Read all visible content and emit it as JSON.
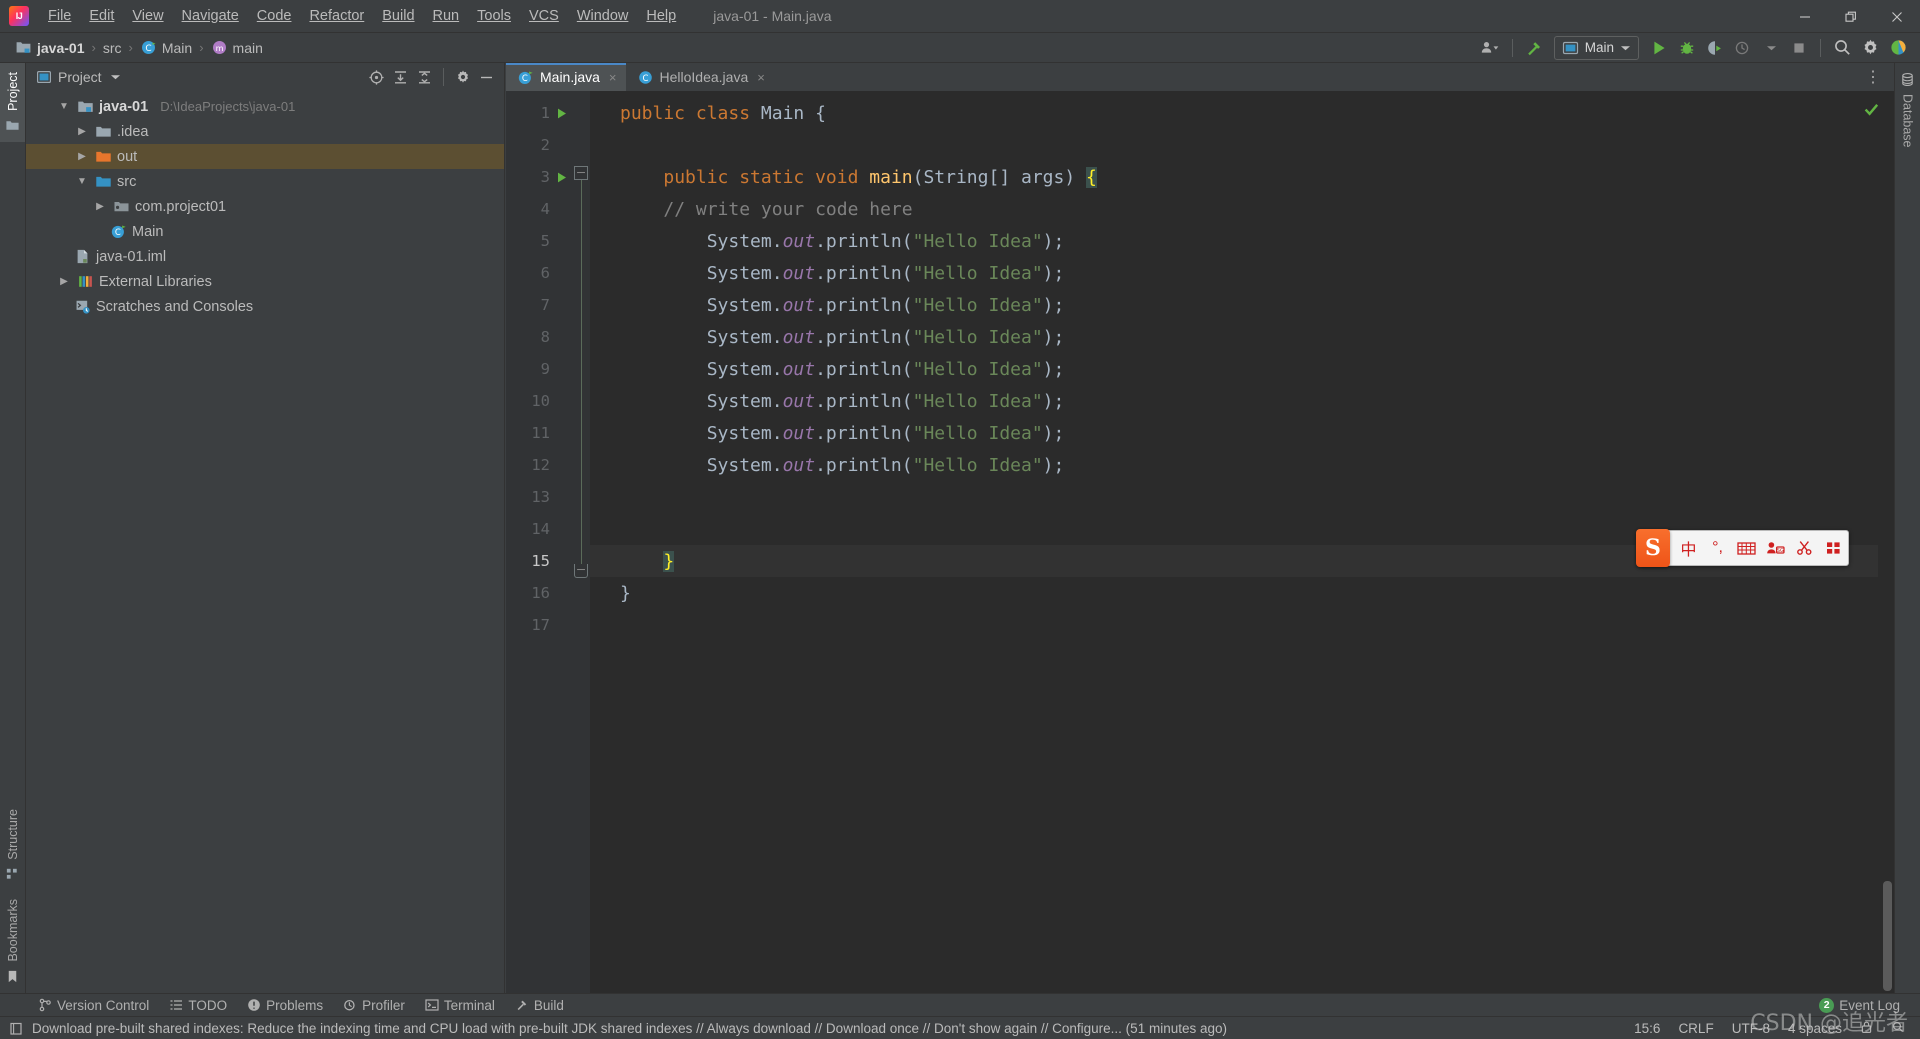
{
  "window": {
    "title": "java-01 - Main.java",
    "minimize_label": "Minimize",
    "restore_label": "Restore",
    "close_label": "Close"
  },
  "menu": {
    "items": [
      {
        "label": "File"
      },
      {
        "label": "Edit"
      },
      {
        "label": "View"
      },
      {
        "label": "Navigate"
      },
      {
        "label": "Code"
      },
      {
        "label": "Refactor"
      },
      {
        "label": "Build"
      },
      {
        "label": "Run"
      },
      {
        "label": "Tools"
      },
      {
        "label": "VCS"
      },
      {
        "label": "Window"
      },
      {
        "label": "Help"
      }
    ]
  },
  "navbar": {
    "breadcrumbs": [
      {
        "label": "java-01",
        "icon": "project-icon"
      },
      {
        "label": "src",
        "icon": "folder-icon"
      },
      {
        "label": "Main",
        "icon": "class-icon"
      },
      {
        "label": "main",
        "icon": "method-icon"
      }
    ],
    "separator": "›",
    "run_config": "Main",
    "buttons": {
      "account": "Account",
      "build_hammer": "Build Project",
      "run": "Run 'Main'",
      "debug": "Debug 'Main'",
      "run_coverage": "Run with Coverage",
      "profile": "Profile",
      "stop": "Stop",
      "search_everywhere": "Search Everywhere",
      "settings": "Settings",
      "updates": "Updates"
    }
  },
  "left_stripe": {
    "top": [
      {
        "label": "Project",
        "icon": "project-folder-icon",
        "active": true
      }
    ],
    "bottom": [
      {
        "label": "Structure",
        "icon": "structure-icon",
        "active": false
      },
      {
        "label": "Bookmarks",
        "icon": "bookmark-icon",
        "active": false
      }
    ]
  },
  "right_stripe": {
    "items": [
      {
        "label": "Database",
        "icon": "database-icon",
        "active": false
      }
    ]
  },
  "project_panel": {
    "title": "Project",
    "header_buttons": [
      {
        "name": "select-opened-file-icon",
        "label": "Select Opened File"
      },
      {
        "name": "expand-all-icon",
        "label": "Expand All"
      },
      {
        "name": "collapse-all-icon",
        "label": "Collapse All"
      },
      {
        "name": "gear-icon",
        "label": "Options"
      },
      {
        "name": "hide-icon",
        "label": "Hide"
      }
    ],
    "tree": [
      {
        "label": "java-01",
        "path": "D:\\IdeaProjects\\java-01",
        "depth": 0,
        "arrow": "expanded",
        "icon": "project-root-icon",
        "bold": true,
        "selected": false
      },
      {
        "label": ".idea",
        "path": "",
        "depth": 1,
        "arrow": "collapsed",
        "icon": "folder-icon",
        "bold": false,
        "selected": false
      },
      {
        "label": "out",
        "path": "",
        "depth": 1,
        "arrow": "collapsed",
        "icon": "folder-excluded-icon",
        "bold": false,
        "selected": true
      },
      {
        "label": "src",
        "path": "",
        "depth": 1,
        "arrow": "expanded",
        "icon": "folder-source-icon",
        "bold": false,
        "selected": false
      },
      {
        "label": "com.project01",
        "path": "",
        "depth": 2,
        "arrow": "collapsed",
        "icon": "package-icon",
        "bold": false,
        "selected": false
      },
      {
        "label": "Main",
        "path": "",
        "depth": 2,
        "arrow": "none",
        "icon": "class-runnable-icon",
        "bold": false,
        "selected": false
      },
      {
        "label": "java-01.iml",
        "path": "",
        "depth": 1,
        "arrow": "none",
        "icon": "iml-file-icon",
        "bold": false,
        "selected": false
      },
      {
        "label": "External Libraries",
        "path": "",
        "depth": 0,
        "arrow": "collapsed",
        "icon": "libraries-icon",
        "bold": false,
        "selected": false
      },
      {
        "label": "Scratches and Consoles",
        "path": "",
        "depth": 0,
        "arrow": "none",
        "icon": "scratches-icon",
        "bold": false,
        "selected": false
      }
    ]
  },
  "editor": {
    "tabs": [
      {
        "label": "Main.java",
        "icon": "class-runnable-icon",
        "active": true,
        "close": "×"
      },
      {
        "label": "HelloIdea.java",
        "icon": "class-icon",
        "active": false,
        "close": "×"
      }
    ],
    "more_label": "⋮",
    "inspection_status": "no-errors",
    "caret_line": 15,
    "lines": [
      {
        "n": 1,
        "run": true,
        "caret": false,
        "tokens": [
          {
            "t": "public ",
            "c": "kw"
          },
          {
            "t": "class ",
            "c": "kw"
          },
          {
            "t": "Main {",
            "c": "plain"
          }
        ]
      },
      {
        "n": 2,
        "run": false,
        "caret": false,
        "tokens": []
      },
      {
        "n": 3,
        "run": true,
        "caret": false,
        "tokens": [
          {
            "t": "    ",
            "c": "plain"
          },
          {
            "t": "public ",
            "c": "kw"
          },
          {
            "t": "static ",
            "c": "kw"
          },
          {
            "t": "void ",
            "c": "kw"
          },
          {
            "t": "main",
            "c": "fn"
          },
          {
            "t": "(String[] args) ",
            "c": "plain"
          },
          {
            "t": "{",
            "c": "brace-hl"
          }
        ]
      },
      {
        "n": 4,
        "run": false,
        "caret": false,
        "tokens": [
          {
            "t": "    ",
            "c": "plain"
          },
          {
            "t": "// write your code here",
            "c": "cmt"
          }
        ]
      },
      {
        "n": 5,
        "run": false,
        "caret": false,
        "tokens": [
          {
            "t": "        System.",
            "c": "plain"
          },
          {
            "t": "out",
            "c": "fld"
          },
          {
            "t": ".println(",
            "c": "plain"
          },
          {
            "t": "\"Hello Idea\"",
            "c": "str"
          },
          {
            "t": ");",
            "c": "plain"
          }
        ]
      },
      {
        "n": 6,
        "run": false,
        "caret": false,
        "tokens": [
          {
            "t": "        System.",
            "c": "plain"
          },
          {
            "t": "out",
            "c": "fld"
          },
          {
            "t": ".println(",
            "c": "plain"
          },
          {
            "t": "\"Hello Idea\"",
            "c": "str"
          },
          {
            "t": ");",
            "c": "plain"
          }
        ]
      },
      {
        "n": 7,
        "run": false,
        "caret": false,
        "tokens": [
          {
            "t": "        System.",
            "c": "plain"
          },
          {
            "t": "out",
            "c": "fld"
          },
          {
            "t": ".println(",
            "c": "plain"
          },
          {
            "t": "\"Hello Idea\"",
            "c": "str"
          },
          {
            "t": ");",
            "c": "plain"
          }
        ]
      },
      {
        "n": 8,
        "run": false,
        "caret": false,
        "tokens": [
          {
            "t": "        System.",
            "c": "plain"
          },
          {
            "t": "out",
            "c": "fld"
          },
          {
            "t": ".println(",
            "c": "plain"
          },
          {
            "t": "\"Hello Idea\"",
            "c": "str"
          },
          {
            "t": ");",
            "c": "plain"
          }
        ]
      },
      {
        "n": 9,
        "run": false,
        "caret": false,
        "tokens": [
          {
            "t": "        System.",
            "c": "plain"
          },
          {
            "t": "out",
            "c": "fld"
          },
          {
            "t": ".println(",
            "c": "plain"
          },
          {
            "t": "\"Hello Idea\"",
            "c": "str"
          },
          {
            "t": ");",
            "c": "plain"
          }
        ]
      },
      {
        "n": 10,
        "run": false,
        "caret": false,
        "tokens": [
          {
            "t": "        System.",
            "c": "plain"
          },
          {
            "t": "out",
            "c": "fld"
          },
          {
            "t": ".println(",
            "c": "plain"
          },
          {
            "t": "\"Hello Idea\"",
            "c": "str"
          },
          {
            "t": ");",
            "c": "plain"
          }
        ]
      },
      {
        "n": 11,
        "run": false,
        "caret": false,
        "tokens": [
          {
            "t": "        System.",
            "c": "plain"
          },
          {
            "t": "out",
            "c": "fld"
          },
          {
            "t": ".println(",
            "c": "plain"
          },
          {
            "t": "\"Hello Idea\"",
            "c": "str"
          },
          {
            "t": ");",
            "c": "plain"
          }
        ]
      },
      {
        "n": 12,
        "run": false,
        "caret": false,
        "tokens": [
          {
            "t": "        System.",
            "c": "plain"
          },
          {
            "t": "out",
            "c": "fld"
          },
          {
            "t": ".println(",
            "c": "plain"
          },
          {
            "t": "\"Hello Idea\"",
            "c": "str"
          },
          {
            "t": ");",
            "c": "plain"
          }
        ]
      },
      {
        "n": 13,
        "run": false,
        "caret": false,
        "tokens": []
      },
      {
        "n": 14,
        "run": false,
        "caret": false,
        "tokens": []
      },
      {
        "n": 15,
        "run": false,
        "caret": true,
        "tokens": [
          {
            "t": "    ",
            "c": "plain"
          },
          {
            "t": "}",
            "c": "brace-hl"
          }
        ]
      },
      {
        "n": 16,
        "run": false,
        "caret": false,
        "tokens": [
          {
            "t": "}",
            "c": "plain"
          }
        ]
      },
      {
        "n": 17,
        "run": false,
        "caret": false,
        "tokens": []
      }
    ]
  },
  "bottom_bar": {
    "windows": [
      {
        "label": "Version Control",
        "icon": "branch-icon"
      },
      {
        "label": "TODO",
        "icon": "todo-icon"
      },
      {
        "label": "Problems",
        "icon": "problems-icon"
      },
      {
        "label": "Profiler",
        "icon": "profiler-icon"
      },
      {
        "label": "Terminal",
        "icon": "terminal-icon"
      },
      {
        "label": "Build",
        "icon": "build-hammer-icon"
      }
    ],
    "event_log": {
      "label": "Event Log",
      "count": "2"
    }
  },
  "status_bar": {
    "message": "Download pre-built shared indexes: Reduce the indexing time and CPU load with pre-built JDK shared indexes // Always download // Download once // Don't show again // Configure... (51 minutes ago)",
    "message_icon": "notification-icon",
    "items": [
      {
        "label": "15:6",
        "name": "caret-position"
      },
      {
        "label": "CRLF",
        "name": "line-separator"
      },
      {
        "label": "UTF-8",
        "name": "file-encoding"
      },
      {
        "label": "4 spaces",
        "name": "indent-setting"
      }
    ],
    "lock_icon": "lock-icon",
    "inspector_icon": "inspector-icon"
  },
  "ime_toolbar": {
    "logo": "S",
    "buttons": [
      {
        "label": "中",
        "name": "language-mode"
      },
      {
        "label": "°,",
        "name": "punctuation-mode"
      },
      {
        "label": "⌨",
        "name": "soft-keyboard"
      },
      {
        "label": "☺",
        "name": "emoji-input"
      },
      {
        "label": "✂",
        "name": "screenshot-tool"
      },
      {
        "label": "☰",
        "name": "toolbox"
      }
    ]
  },
  "watermark": {
    "text": "CSDN @追光者"
  }
}
